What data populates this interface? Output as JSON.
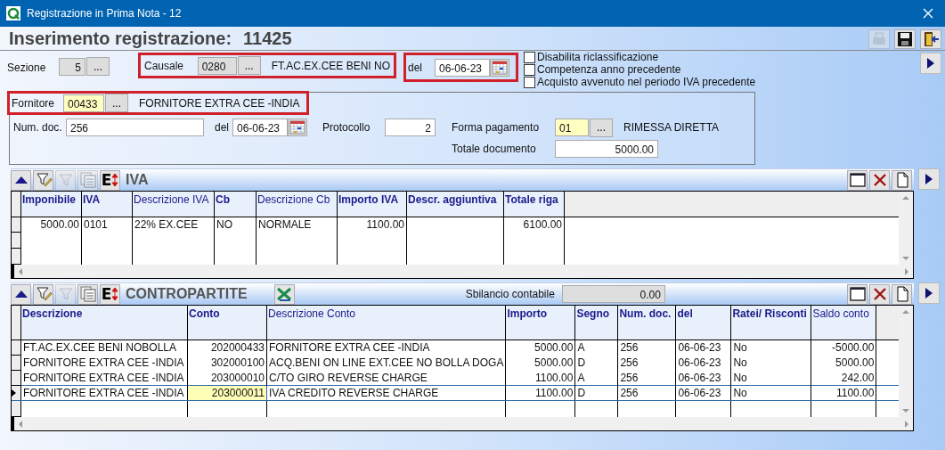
{
  "window": {
    "title": "Registrazione in Prima Nota - 12"
  },
  "header": {
    "title": "Inserimento registrazione:",
    "number": "11425",
    "tools": [
      {
        "kind": "print",
        "disabled": true
      },
      {
        "kind": "save",
        "disabled": false
      },
      {
        "kind": "exit",
        "disabled": false
      }
    ]
  },
  "sezione": {
    "label": "Sezione",
    "value": "5",
    "button": "...",
    "kind": "readonly"
  },
  "causale": {
    "label": "Causale",
    "code": "0280",
    "button": "...",
    "description": "FT.AC.EX.CEE BENI NO",
    "kind": "readonly",
    "highlighted": true
  },
  "date": {
    "label": "del",
    "value": "06-06-23",
    "highlighted": true
  },
  "options": [
    {
      "label": "Disabilita riclassificazione",
      "checked": false
    },
    {
      "label": "Competenza anno precedente",
      "checked": false
    },
    {
      "label": "Acquisto avvenuto nel periodo IVA precedente",
      "checked": false
    }
  ],
  "document": {
    "fornitore": {
      "label": "Fornitore",
      "code": "00433",
      "button": "...",
      "description": "FORNITORE EXTRA CEE -INDIA",
      "kind": "required",
      "highlighted": true
    },
    "num_doc": {
      "label": "Num. doc.",
      "value": "256"
    },
    "doc_date": {
      "label": "del",
      "value": "06-06-23"
    },
    "protocollo": {
      "label": "Protocollo",
      "value": "2"
    },
    "forma_pagamento": {
      "label": "Forma pagamento",
      "code": "01",
      "button": "...",
      "description": "RIMESSA DIRETTA",
      "kind": "required"
    },
    "totale": {
      "label": "Totale documento",
      "value": "5000.00"
    }
  },
  "iva": {
    "title": "IVA",
    "tools": [
      {
        "kind": "collapse",
        "disabled": false
      },
      {
        "kind": "edit",
        "disabled": false
      },
      {
        "kind": "filter",
        "disabled": true
      },
      {
        "kind": "list",
        "disabled": true
      },
      {
        "kind": "export",
        "glyph": "E",
        "disabled": false
      }
    ],
    "columns": [
      {
        "label": "Imponibile",
        "bold": true,
        "numeric": true
      },
      {
        "label": "IVA",
        "bold": true,
        "numeric": false
      },
      {
        "label": "Descrizione IVA",
        "bold": false,
        "numeric": false
      },
      {
        "label": "Cb",
        "bold": true,
        "numeric": false
      },
      {
        "label": "Descrizione Cb",
        "bold": false,
        "numeric": false
      },
      {
        "label": "Importo IVA",
        "bold": true,
        "numeric": true
      },
      {
        "label": "Descr. aggiuntiva",
        "bold": true
      },
      {
        "label": "Totale riga",
        "bold": true,
        "numeric": true
      }
    ],
    "rows": [
      {
        "selected": false,
        "cells": [
          {
            "text": "5000.00",
            "focused": false
          },
          {
            "text": "0101",
            "focused": false
          },
          {
            "text": "22% EX.CEE",
            "focused": false
          },
          {
            "text": "NO",
            "focused": false
          },
          {
            "text": "NORMALE",
            "focused": false
          },
          {
            "text": "1100.00",
            "focused": false
          },
          {
            "focused": false
          },
          {
            "text": "6100.00",
            "focused": false
          }
        ]
      }
    ]
  },
  "contropartite": {
    "title": "CONTROPARTITE",
    "tools": [
      {
        "kind": "collapse",
        "disabled": false
      },
      {
        "kind": "edit",
        "disabled": false
      },
      {
        "kind": "filter",
        "disabled": true
      },
      {
        "kind": "list",
        "disabled": false
      },
      {
        "kind": "export",
        "glyph": "E",
        "disabled": false
      },
      {
        "kind": "excel",
        "disabled": false
      }
    ],
    "balance": {
      "label": "Sbilancio contabile",
      "value": "0.00"
    },
    "columns": [
      {
        "label": "Descrizione",
        "bold": true,
        "numeric": false
      },
      {
        "label": "Conto",
        "bold": true,
        "numeric": true
      },
      {
        "label": "Descrizione Conto",
        "bold": false,
        "numeric": false
      },
      {
        "label": "Importo",
        "bold": true,
        "numeric": true
      },
      {
        "label": "Segno",
        "bold": true,
        "numeric": false
      },
      {
        "label": "Num. doc.",
        "bold": true,
        "numeric": false
      },
      {
        "label": "del",
        "bold": true,
        "numeric": false
      },
      {
        "label": "Ratei/ Risconti",
        "bold": true,
        "numeric": false
      },
      {
        "label": "Saldo conto",
        "bold": false,
        "numeric": true
      }
    ],
    "rows": [
      {
        "selected": false,
        "cells": [
          {
            "text": "FT.AC.EX.CEE BENI NOBOLLA",
            "focused": false
          },
          {
            "text": "202000433",
            "focused": false
          },
          {
            "text": "FORNITORE EXTRA CEE -INDIA",
            "focused": false
          },
          {
            "text": "5000.00",
            "focused": false
          },
          {
            "text": "A",
            "focused": false
          },
          {
            "text": "256",
            "focused": false
          },
          {
            "text": "06-06-23",
            "focused": false
          },
          {
            "text": "No",
            "focused": false
          },
          {
            "text": "-5000.00",
            "focused": false
          }
        ]
      },
      {
        "selected": false,
        "cells": [
          {
            "text": "FORNITORE EXTRA CEE -INDIA",
            "focused": false
          },
          {
            "text": "302000100",
            "focused": false
          },
          {
            "text": "ACQ.BENI ON LINE EXT.CEE NO BOLLA DOGA",
            "focused": false
          },
          {
            "text": "5000.00",
            "focused": false
          },
          {
            "text": "D",
            "focused": false
          },
          {
            "text": "256",
            "focused": false
          },
          {
            "text": "06-06-23",
            "focused": false
          },
          {
            "text": "No",
            "focused": false
          },
          {
            "text": "5000.00",
            "focused": false
          }
        ]
      },
      {
        "selected": false,
        "cells": [
          {
            "text": "FORNITORE EXTRA CEE -INDIA",
            "focused": false
          },
          {
            "text": "203000010",
            "focused": false
          },
          {
            "text": "C/TO GIRO REVERSE CHARGE",
            "focused": false
          },
          {
            "text": "1100.00",
            "focused": false
          },
          {
            "text": "A",
            "focused": false
          },
          {
            "text": "256",
            "focused": false
          },
          {
            "text": "06-06-23",
            "focused": false
          },
          {
            "text": "No",
            "focused": false
          },
          {
            "text": "242.00",
            "focused": false
          }
        ]
      },
      {
        "selected": true,
        "cells": [
          {
            "text": "FORNITORE EXTRA CEE -INDIA",
            "focused": false
          },
          {
            "text": "203000011",
            "focused": true
          },
          {
            "text": "IVA CREDITO REVERSE CHARGE",
            "focused": false
          },
          {
            "text": "1100.00",
            "focused": false
          },
          {
            "text": "D",
            "focused": false
          },
          {
            "text": "256",
            "focused": false
          },
          {
            "text": "06-06-23",
            "focused": false
          },
          {
            "text": "No",
            "focused": false
          },
          {
            "text": "1100.00",
            "focused": false
          }
        ]
      }
    ]
  }
}
